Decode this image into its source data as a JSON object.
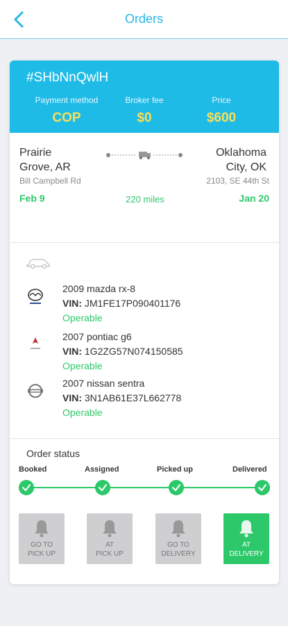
{
  "header": {
    "title": "Orders"
  },
  "order": {
    "id": "#SHbNnQwlH",
    "payment_label": "Payment method",
    "payment_value": "COP",
    "broker_label": "Broker fee",
    "broker_value": "$0",
    "price_label": "Price",
    "price_value": "$600"
  },
  "route": {
    "origin_line1": "Prairie",
    "origin_line2": "Grove, AR",
    "origin_street": "Bill Campbell Rd",
    "origin_date": "Feb 9",
    "dest_line1": "Oklahoma",
    "dest_line2": "City, OK",
    "dest_street": "2103, SE 44th St",
    "dest_date": "Jan 20",
    "distance": "220 miles"
  },
  "vehicles": [
    {
      "name": "2009 mazda rx-8",
      "vin_label": "VIN:",
      "vin": "JM1FE17P090401176",
      "condition": "Operable",
      "logo": "mazda-logo"
    },
    {
      "name": "2007 pontiac g6",
      "vin_label": "VIN:",
      "vin": "1G2ZG57N074150585",
      "condition": "Operable",
      "logo": "pontiac-logo"
    },
    {
      "name": "2007 nissan sentra",
      "vin_label": "VIN:",
      "vin": "3N1AB61E37L662778",
      "condition": "Operable",
      "logo": "nissan-logo"
    }
  ],
  "status": {
    "title": "Order status",
    "steps": [
      "Booked",
      "Assigned",
      "Picked up",
      "Delivered"
    ],
    "completed": 4
  },
  "actions": [
    {
      "line1": "GO TO",
      "line2": "PICK UP",
      "active": false
    },
    {
      "line1": "AT",
      "line2": "PICK UP",
      "active": false
    },
    {
      "line1": "GO TO",
      "line2": "DELIVERY",
      "active": false
    },
    {
      "line1": "AT",
      "line2": "DELIVERY",
      "active": true
    }
  ],
  "colors": {
    "accent": "#1fbbe7",
    "success": "#2dc86a",
    "highlight": "#f6e05a",
    "inactive": "#cfcfd1"
  }
}
